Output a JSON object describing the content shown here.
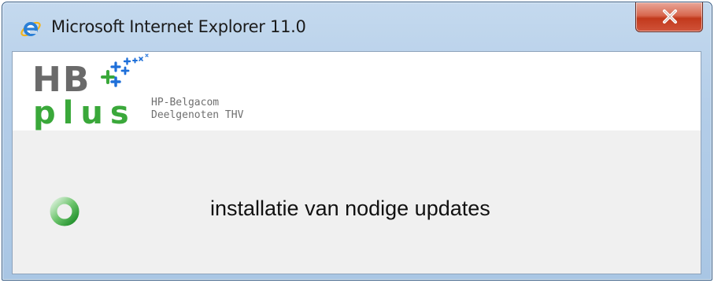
{
  "window": {
    "title": "Microsoft Internet Explorer 11.0",
    "icon": "internet-explorer-icon",
    "close_icon": "close-icon"
  },
  "logo": {
    "hb": "HB",
    "plus": "plus",
    "company_line1": "HP-Belgacom",
    "company_line2": "Deelgenoten THV",
    "colors": {
      "gray": "#6a6a6a",
      "green": "#3aa83a",
      "blue": "#1e6fd9"
    }
  },
  "status": {
    "message": "installatie van nodige updates",
    "spinner_icon": "loading-spinner-icon",
    "spinner_color": "#3aa83a"
  }
}
